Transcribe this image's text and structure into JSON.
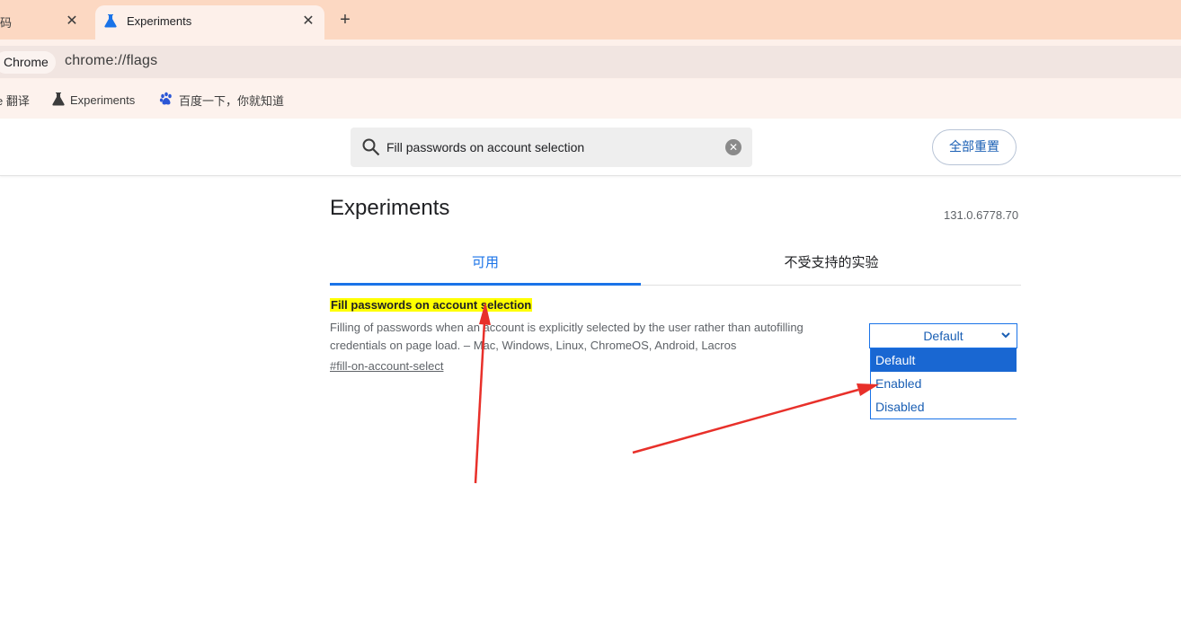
{
  "browser": {
    "prev_tab_title": "码",
    "active_tab_title": "Experiments",
    "new_tab": "+",
    "close_glyph": "✕",
    "chip_label": "Chrome",
    "url": "chrome://flags"
  },
  "bookmarks": [
    {
      "label": "e 翻译",
      "icon": "translate-icon"
    },
    {
      "label": "Experiments",
      "icon": "flask-icon"
    },
    {
      "label": "百度一下，你就知道",
      "icon": "paw-icon"
    }
  ],
  "search": {
    "value": "Fill passwords on account selection",
    "clear_glyph": "✕"
  },
  "reset_button": "全部重置",
  "page": {
    "heading": "Experiments",
    "version": "131.0.6778.70",
    "tabs": [
      "可用",
      "不受支持的实验"
    ]
  },
  "flag": {
    "title": "Fill passwords on account selection",
    "description": "Filling of passwords when an account is explicitly selected by the user rather than autofilling credentials on page load. – Mac, Windows, Linux, ChromeOS, Android, Lacros",
    "link": "#fill-on-account-select",
    "selected": "Default",
    "options": [
      "Default",
      "Enabled",
      "Disabled"
    ]
  },
  "colors": {
    "accent": "#1a73e8",
    "highlight": "#ffff00",
    "annotation_arrow": "#e8302a",
    "tabstrip": "#fcd8c2"
  }
}
